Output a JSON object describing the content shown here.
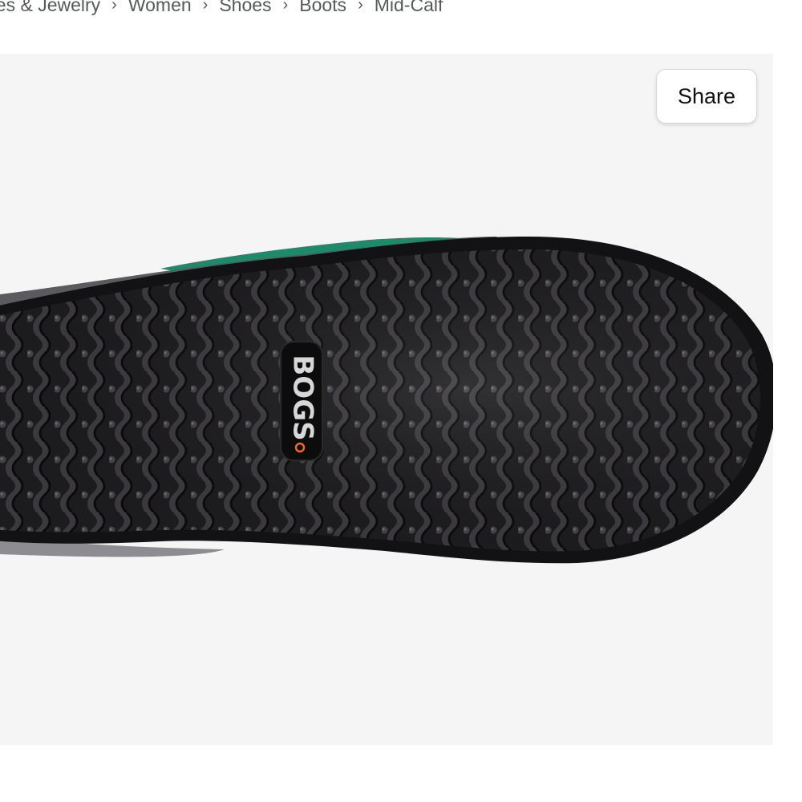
{
  "breadcrumb": {
    "items": [
      "oes & Jewelry",
      "Women",
      "Shoes",
      "Boots",
      "Mid-Calf"
    ],
    "separator": "›"
  },
  "share": {
    "label": "Share"
  },
  "product_image": {
    "logo_text": "BOGS",
    "sole_color": "#1c1b1d",
    "upper_accent_color": "#1f8a6a",
    "logo_dot_color": "#f26a21"
  }
}
